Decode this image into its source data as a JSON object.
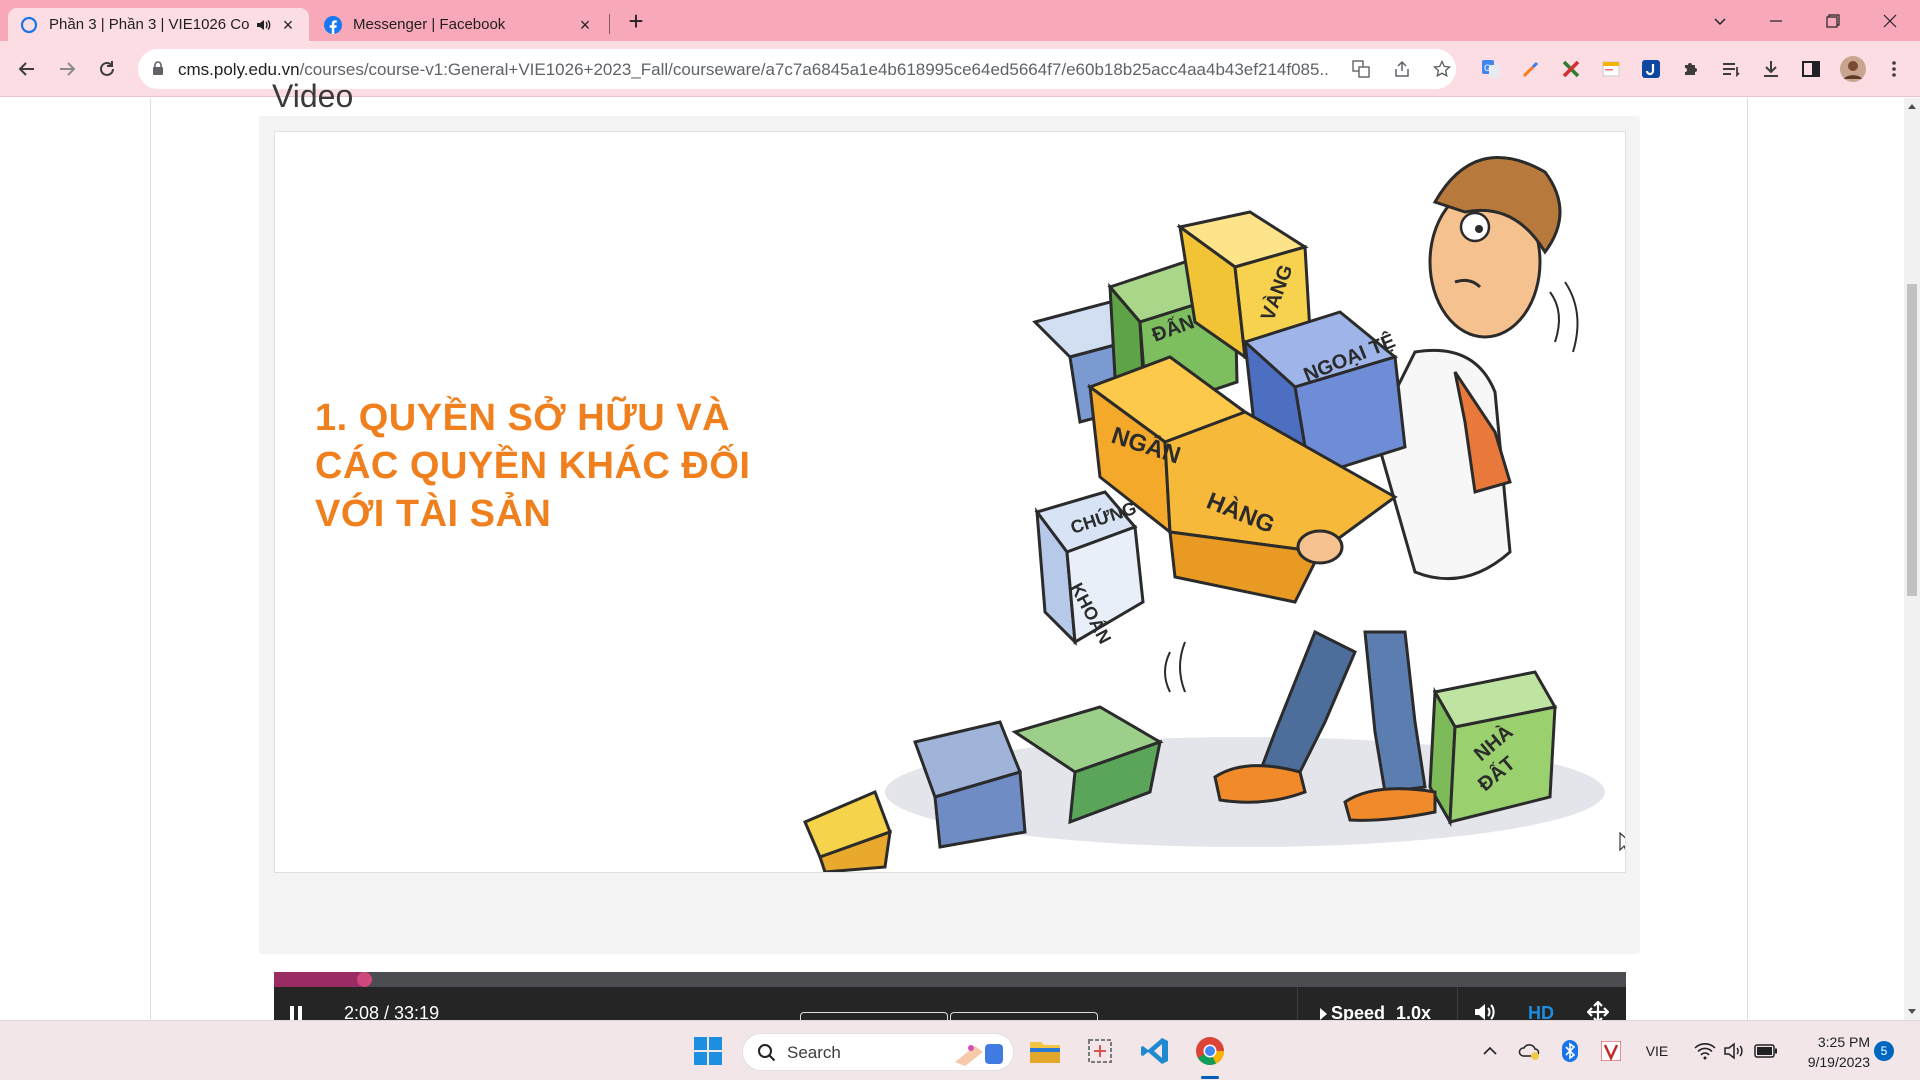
{
  "browser": {
    "tabs": [
      {
        "title": "Phần 3 | Phần 3 | VIE1026 Co",
        "active": true,
        "audio": true
      },
      {
        "title": "Messenger | Facebook",
        "active": false
      }
    ],
    "url_host": "cms.poly.edu.vn",
    "url_path": "/courses/course-v1:General+VIE1026+2023_Fall/courseware/a7c7a6845a1e4b618995ce64ed5664f7/e60b18b25acc4aa4b43ef214f085...",
    "extensions": [
      "google-translate-icon",
      "color-picker-icon",
      "cross-extension-icon",
      "notes-extension-icon",
      "j-extension-icon",
      "puzzle-icon",
      "reading-list-icon",
      "download-icon",
      "side-panel-icon",
      "profile-avatar"
    ]
  },
  "page": {
    "section_title": "Video"
  },
  "video": {
    "slide_title_lines": [
      "1. QUYỀN SỞ HỮU VÀ",
      "CÁC QUYỀN KHÁC ĐỐI",
      "VỚI TÀI SẢN"
    ],
    "box_labels": {
      "dan_le": "ĐẤN LẺ",
      "vang": "VÀNG",
      "ngoai_te": "NGOẠI TỆ",
      "ngan_hang_1": "NGÂN",
      "ngan_hang_2": "HÀNG",
      "chung_khoan_1": "CHỨNG",
      "chung_khoan_2": "KHOÁN",
      "nha_dat_1": "NHÀ",
      "nha_dat_2": "ĐẤT"
    },
    "progress_fraction": 0.064,
    "time_display": "2:08 / 33:19",
    "speed_label": "Speed",
    "speed_value": "1.0x",
    "hd_label": "HD",
    "accent_played": "#9b2c63",
    "accent_hd": "#1b8ee0"
  },
  "taskbar": {
    "search_label": "Search",
    "language": "VIE",
    "time": "3:25 PM",
    "date": "9/19/2023",
    "notification_count": "5"
  }
}
